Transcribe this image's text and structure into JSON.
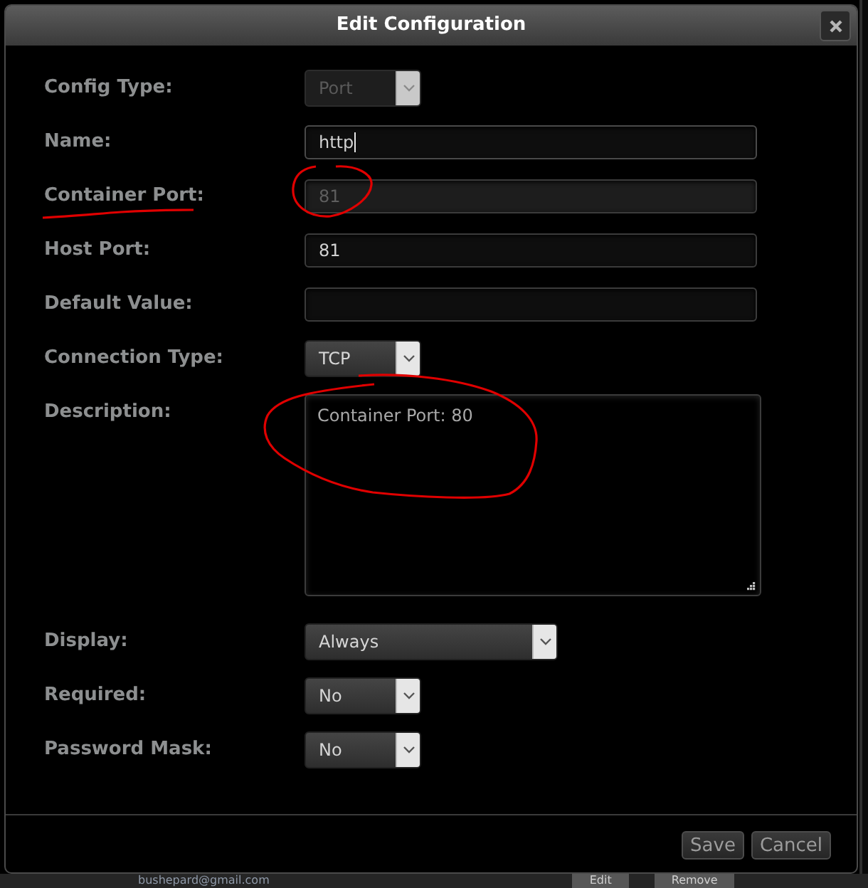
{
  "dialog": {
    "title": "Edit Configuration"
  },
  "fields": [
    {
      "kind": "select",
      "label": "Config Type:",
      "value": "Port",
      "disabled": true,
      "focused": false
    },
    {
      "kind": "input",
      "label": "Name:",
      "value": "http",
      "disabled": false,
      "focused": true
    },
    {
      "kind": "input",
      "label": "Container Port:",
      "value": "81",
      "disabled": true,
      "focused": false
    },
    {
      "kind": "input",
      "label": "Host Port:",
      "value": "81",
      "disabled": false,
      "focused": false
    },
    {
      "kind": "input",
      "label": "Default Value:",
      "disabled": false,
      "focused": false
    },
    {
      "kind": "select",
      "label": "Connection Type:",
      "value": "TCP",
      "disabled": false,
      "focused": false
    },
    {
      "kind": "textarea",
      "label": "Description:",
      "value": "Container Port: 80",
      "disabled": false,
      "focused": false
    },
    {
      "kind": "select",
      "label": "Display:",
      "value": "Always",
      "disabled": false,
      "focused": false
    },
    {
      "kind": "select",
      "label": "Required:",
      "value": "No",
      "disabled": false,
      "focused": false
    },
    {
      "kind": "select",
      "label": "Password Mask:",
      "value": "No",
      "disabled": false,
      "focused": false
    }
  ],
  "buttons": [
    {
      "label": "Save"
    },
    {
      "label": "Cancel"
    }
  ],
  "background_page": {
    "email": "bushepard@gmail.com",
    "buttons": [
      {
        "label": "Edit"
      },
      {
        "label": "Remove"
      }
    ]
  }
}
